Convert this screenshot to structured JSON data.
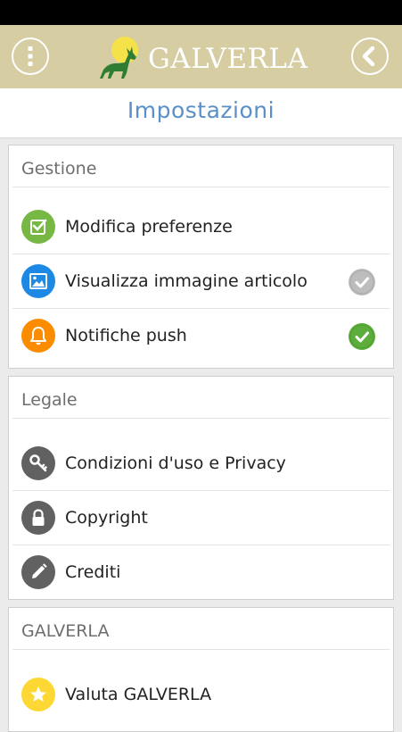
{
  "header": {
    "logo_text": "GALVERLA",
    "menu_icon": "vertical-dots-icon",
    "back_icon": "chevron-left-icon",
    "background_color": "#d6cda2"
  },
  "page": {
    "title": "Impostazioni",
    "title_color": "#5a8fc8"
  },
  "sections": [
    {
      "title": "Gestione",
      "items": [
        {
          "label": "Modifica preferenze",
          "icon": "check-square-icon",
          "icon_color": "#76b843",
          "toggle": null
        },
        {
          "label": "Visualizza immagine articolo",
          "icon": "image-icon",
          "icon_color": "#1e88e5",
          "toggle": "off"
        },
        {
          "label": "Notifiche push",
          "icon": "bell-icon",
          "icon_color": "#fb8c00",
          "toggle": "on"
        }
      ]
    },
    {
      "title": "Legale",
      "items": [
        {
          "label": "Condizioni d'uso e Privacy",
          "icon": "key-icon",
          "icon_color": "#616161"
        },
        {
          "label": "Copyright",
          "icon": "lock-icon",
          "icon_color": "#616161"
        },
        {
          "label": "Crediti",
          "icon": "pencil-icon",
          "icon_color": "#616161"
        }
      ]
    },
    {
      "title": "GALVERLA",
      "items": [
        {
          "label": "Valuta GALVERLA",
          "icon": "star-icon",
          "icon_color": "#fdd835"
        }
      ]
    }
  ]
}
